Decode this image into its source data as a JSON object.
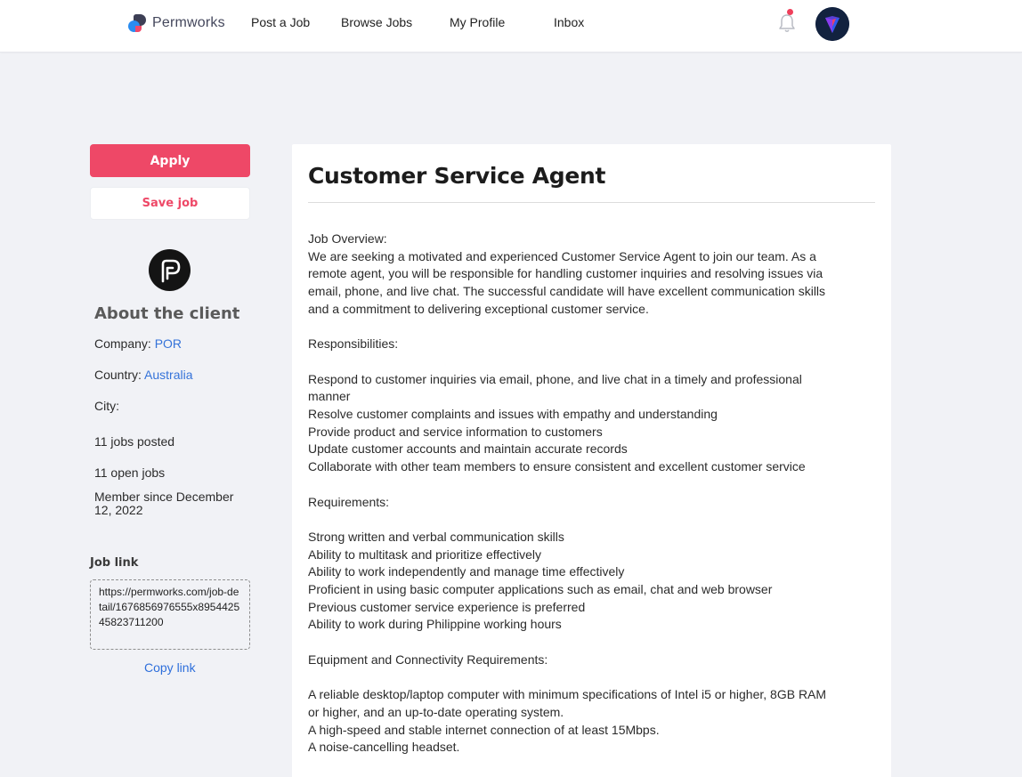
{
  "header": {
    "brand_name": "Permworks",
    "nav": [
      "Post a Job",
      "Browse Jobs",
      "My Profile",
      "Inbox"
    ]
  },
  "sidebar": {
    "apply_label": "Apply",
    "save_label": "Save job",
    "about_title": "About the client",
    "company_label": "Company:",
    "company_value": "POR",
    "country_label": "Country:",
    "country_value": "Australia",
    "city_label": "City:",
    "jobs_posted": "11 jobs posted",
    "open_jobs": "11 open jobs",
    "member_since": "Member since December 12, 2022",
    "job_link_label": "Job link",
    "job_link_url": "https://permworks.com/job-detail/1676856976555x895442545823711200",
    "copy_link_label": "Copy link"
  },
  "job": {
    "title": "Customer Service Agent",
    "description_lines": [
      "Job Overview:",
      "We are seeking a motivated and experienced Customer Service Agent to join our team. As a",
      "remote agent, you will be responsible for handling customer inquiries and resolving issues via",
      "email, phone, and live chat. The successful candidate will have excellent communication skills",
      "and a commitment to delivering exceptional customer service.",
      "",
      "Responsibilities:",
      "",
      "Respond to customer inquiries via email, phone, and live chat in a timely and professional",
      "manner",
      "Resolve customer complaints and issues with empathy and understanding",
      "Provide product and service information to customers",
      "Update customer accounts and maintain accurate records",
      "Collaborate with other team members to ensure consistent and excellent customer service",
      "",
      "Requirements:",
      "",
      "Strong written and verbal communication skills",
      "Ability to multitask and prioritize effectively",
      "Ability to work independently and manage time effectively",
      "Proficient in using basic computer applications such as email, chat and web browser",
      "Previous customer service experience is preferred",
      "Ability to work during Philippine working hours",
      "",
      "Equipment and Connectivity Requirements:",
      "",
      "A reliable desktop/laptop computer with minimum specifications of Intel i5 or higher, 8GB RAM",
      "or higher, and an up-to-date operating system.",
      "A high-speed and stable internet connection of at least 15Mbps.",
      "A noise-cancelling headset."
    ]
  },
  "icons": {
    "brand": "permworks-logo-icon",
    "notifications": "bell-icon",
    "avatar": "user-avatar",
    "client_logo": "client-logo-icon"
  },
  "colors": {
    "accent": "#ee4867",
    "link": "#3573d9",
    "notification_dot": "#ef3f5b"
  }
}
